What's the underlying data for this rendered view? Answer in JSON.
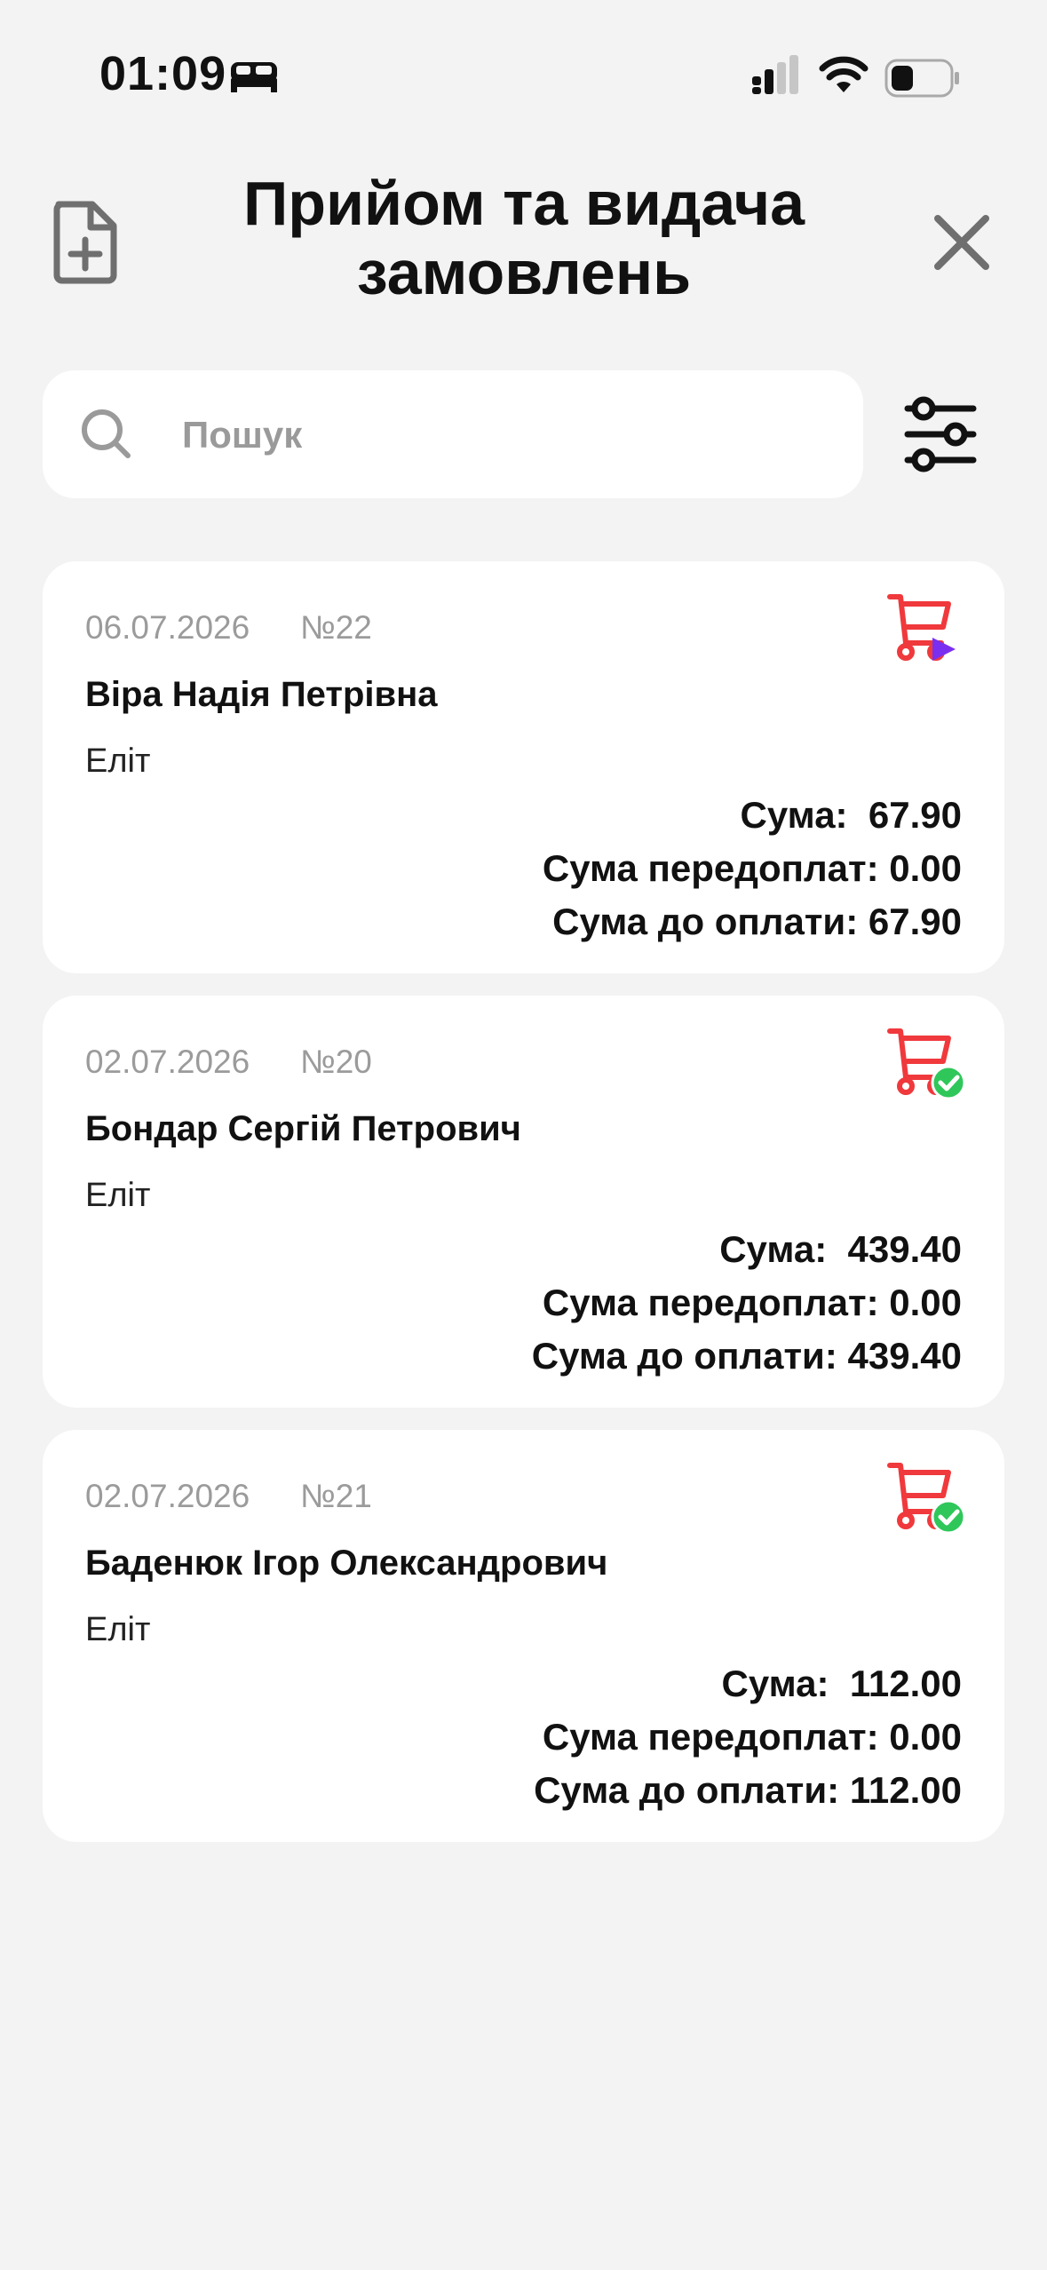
{
  "status_bar": {
    "time": "01:09"
  },
  "header": {
    "title": "Прийом та видача замовлень"
  },
  "search": {
    "placeholder": "Пошук"
  },
  "labels": {
    "sum": "Сума:",
    "prepaid": "Сума передоплат:",
    "to_pay": "Сума до оплати:"
  },
  "colors": {
    "cart": "#f0393c",
    "status_play": "#7a2ff0",
    "status_done": "#2fc75a"
  },
  "orders": [
    {
      "date": "06.07.2026",
      "number": "№22",
      "customer": "Віра Надія Петрівна",
      "group": "Еліт",
      "sum": "67.90",
      "prepaid": "0.00",
      "to_pay": "67.90",
      "status_icon": "cart-play-icon"
    },
    {
      "date": "02.07.2026",
      "number": "№20",
      "customer": "Бондар Сергій Петрович",
      "group": "Еліт",
      "sum": "439.40",
      "prepaid": "0.00",
      "to_pay": "439.40",
      "status_icon": "cart-check-icon"
    },
    {
      "date": "02.07.2026",
      "number": "№21",
      "customer": "Баденюк Ігор Олександрович",
      "group": "Еліт",
      "sum": "112.00",
      "prepaid": "0.00",
      "to_pay": "112.00",
      "status_icon": "cart-check-icon"
    }
  ]
}
